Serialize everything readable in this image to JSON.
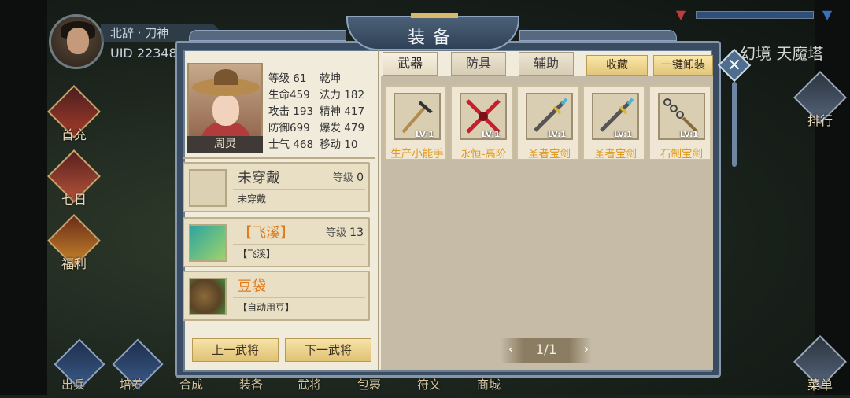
{
  "player": {
    "server_name": "北辞 · 刀神",
    "uid": "UID 22348"
  },
  "realm": "幻境 天魔塔",
  "side_menu": [
    "首充",
    "七日",
    "福利"
  ],
  "right_menu": [
    "排行",
    "菜单"
  ],
  "bottom_menu": [
    "出兵",
    "培养",
    "合成",
    "装备",
    "武将",
    "包裹",
    "符文",
    "商城"
  ],
  "dialog": {
    "title": "装备",
    "close": "×"
  },
  "hero": {
    "name": "周灵",
    "stats": [
      {
        "label": "等级",
        "value": "61"
      },
      {
        "label": "",
        "value": "乾坤"
      },
      {
        "label": "生命",
        "value": "459"
      },
      {
        "label": "法力",
        "value": "182"
      },
      {
        "label": "攻击",
        "value": "193"
      },
      {
        "label": "精神",
        "value": "417"
      },
      {
        "label": "防御",
        "value": "699"
      },
      {
        "label": "爆发",
        "value": "479"
      },
      {
        "label": "士气",
        "value": "468"
      },
      {
        "label": "移动",
        "value": "10"
      }
    ]
  },
  "slots": [
    {
      "name": "未穿戴",
      "level_label": "等级",
      "level": "0",
      "sub": "未穿戴",
      "color": "#3a3a3a"
    },
    {
      "name": "【飞溪】",
      "level_label": "等级",
      "level": "13",
      "sub": "【飞溪】",
      "color": "#e07b1b"
    },
    {
      "name": "豆袋",
      "level_label": "",
      "level": "",
      "sub": "【自动用豆】",
      "color": "#e07b1b"
    }
  ],
  "nav_buttons": {
    "prev": "上一武将",
    "next": "下一武将"
  },
  "tabs": [
    "武器",
    "防具",
    "辅助"
  ],
  "actions": {
    "favorite": "收藏",
    "unequip_all": "一键卸装"
  },
  "items": [
    {
      "name": "生产小能手",
      "lv": "LV:1",
      "icon": "pickaxe-icon"
    },
    {
      "name": "永恒-高阶",
      "lv": "LV:1",
      "icon": "crossed-blades-icon"
    },
    {
      "name": "圣者宝剑",
      "lv": "LV:1",
      "icon": "sword-icon"
    },
    {
      "name": "圣者宝剑",
      "lv": "LV:1",
      "icon": "sword-icon"
    },
    {
      "name": "石制宝剑",
      "lv": "LV:1",
      "icon": "chain-whip-icon"
    }
  ],
  "pager": {
    "prev": "‹",
    "text": "1/1",
    "next": "›"
  },
  "colors": {
    "item_name": "#e29a1f",
    "dialog_frame": "#3a4c61",
    "panel_bg": "#f1ebdc"
  }
}
